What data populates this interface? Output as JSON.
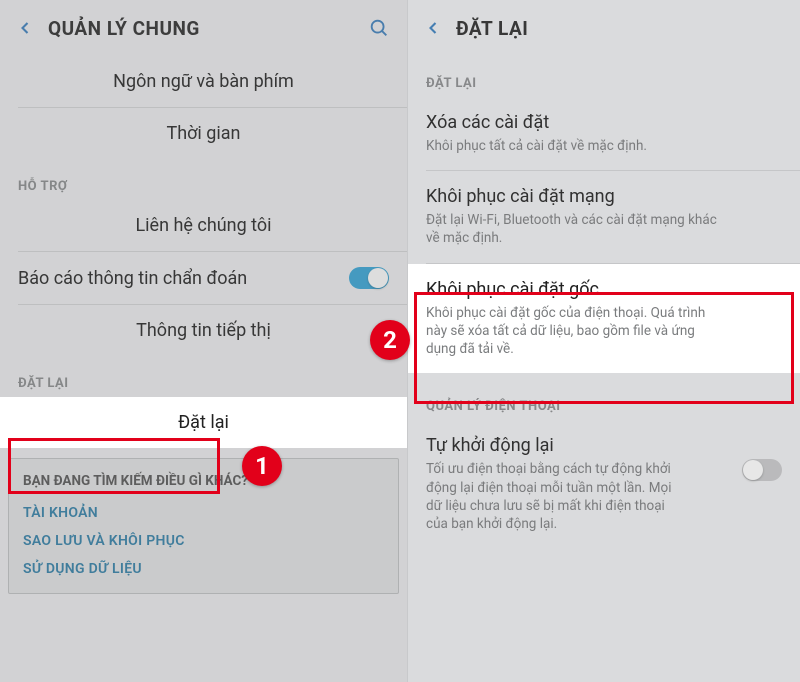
{
  "left": {
    "header": {
      "title": "QUẢN LÝ CHUNG"
    },
    "items": {
      "lang": "Ngôn ngữ và bàn phím",
      "time": "Thời gian",
      "sec_support": "HỖ TRỢ",
      "contact": "Liên hệ chúng tôi",
      "diag": "Báo cáo thông tin chẩn đoán",
      "marketing": "Thông tin tiếp thị",
      "sec_reset": "ĐẶT LẠI",
      "reset": "Đặt lại"
    },
    "card": {
      "header": "BẠN ĐANG TÌM KIẾM ĐIỀU GÌ KHÁC?",
      "links": [
        "TÀI KHOẢN",
        "SAO LƯU VÀ KHÔI PHỤC",
        "SỬ DỤNG DỮ LIỆU"
      ]
    }
  },
  "right": {
    "header": {
      "title": "ĐẶT LẠI"
    },
    "sec_reset": "ĐẶT LẠI",
    "items": [
      {
        "title": "Xóa các cài đặt",
        "sub": "Khôi phục tất cả cài đặt về mặc định."
      },
      {
        "title": "Khôi phục cài đặt mạng",
        "sub": "Đặt lại Wi-Fi, Bluetooth và các cài đặt mạng khác về mặc định."
      },
      {
        "title": "Khôi phục cài đặt gốc",
        "sub": "Khôi phục cài đặt gốc của điện thoại. Quá trình này sẽ xóa tất cả dữ liệu, bao gồm file và ứng dụng đã tải về."
      }
    ],
    "sec_manage": "QUẢN LÝ ĐIỆN THOẠI",
    "autorestart": {
      "title": "Tự khởi động lại",
      "sub": "Tối ưu điện thoại bằng cách tự động khởi động lại điện thoại mỗi tuần một lần. Mọi dữ liệu chưa lưu sẽ bị mất khi điện thoại của bạn khởi động lại."
    }
  },
  "badges": {
    "one": "1",
    "two": "2"
  }
}
